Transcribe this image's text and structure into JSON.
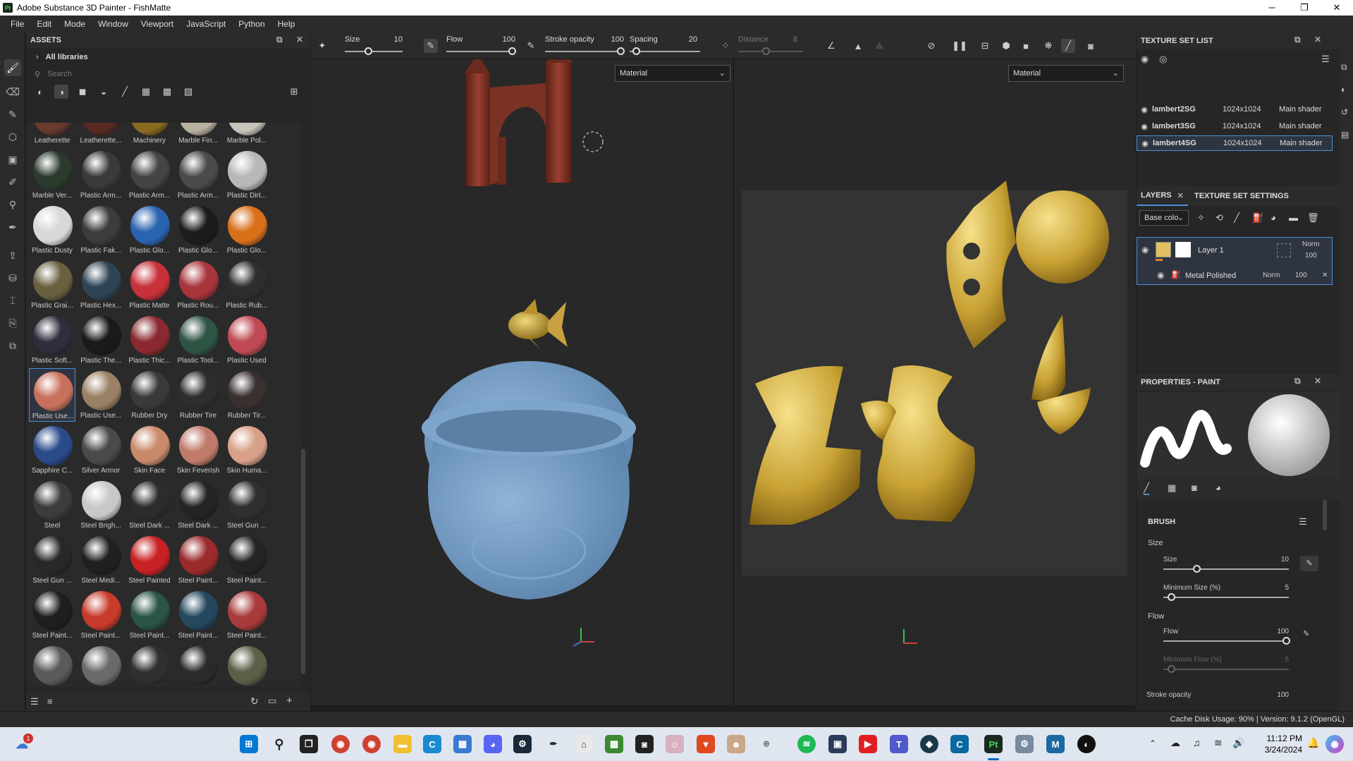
{
  "window": {
    "title": "Adobe Substance 3D Painter - FishMatte",
    "app_icon": "Pt",
    "minimize": "─",
    "maximize": "❐",
    "close": "✕"
  },
  "menu": [
    "File",
    "Edit",
    "Mode",
    "Window",
    "Viewport",
    "JavaScript",
    "Python",
    "Help"
  ],
  "assets": {
    "title": "ASSETS",
    "library": "All libraries",
    "search_placeholder": "Search",
    "materials": [
      {
        "label": "Leatherette",
        "color": "#6a3a2e"
      },
      {
        "label": "Leatherette...",
        "color": "#5a2a22"
      },
      {
        "label": "Machinery",
        "color": "#8a6a20"
      },
      {
        "label": "Marble Fin...",
        "color": "#b8b0a0"
      },
      {
        "label": "Marble Pol...",
        "color": "#c8c4bc"
      },
      {
        "label": "Marble Ver...",
        "color": "#2a3a2c"
      },
      {
        "label": "Plastic Arm...",
        "color": "#3a3a3c"
      },
      {
        "label": "Plastic Arm...",
        "color": "#444446"
      },
      {
        "label": "Plastic Arm...",
        "color": "#4a4a4c"
      },
      {
        "label": "Plastic Dirt...",
        "color": "#b8b8b8"
      },
      {
        "label": "Plastic Dusty",
        "color": "#d8d8d8"
      },
      {
        "label": "Plastic Fak...",
        "color": "#3c3c3e"
      },
      {
        "label": "Plastic Glo...",
        "color": "#2a64b0"
      },
      {
        "label": "Plastic Glo...",
        "color": "#1c1c1e"
      },
      {
        "label": "Plastic Glo...",
        "color": "#d8701a"
      },
      {
        "label": "Plastic Grai...",
        "color": "#6a6040"
      },
      {
        "label": "Plastic Hex...",
        "color": "#2e4454"
      },
      {
        "label": "Plastic Matte",
        "color": "#c8303a"
      },
      {
        "label": "Plastic Rou...",
        "color": "#a8343c"
      },
      {
        "label": "Plastic Rub...",
        "color": "#2e2e2e"
      },
      {
        "label": "Plastic Soft...",
        "color": "#2e2e3e"
      },
      {
        "label": "Plastic The...",
        "color": "#1a1a1c"
      },
      {
        "label": "Plastic Thic...",
        "color": "#8a2a30"
      },
      {
        "label": "Plastic Tool...",
        "color": "#2e5444"
      },
      {
        "label": "Plastic Used",
        "color": "#c04a54"
      },
      {
        "label": "Plastic Use...",
        "color": "#c8705c"
      },
      {
        "label": "Plastic Use...",
        "color": "#9a8064"
      },
      {
        "label": "Rubber Dry",
        "color": "#3a3a3a"
      },
      {
        "label": "Rubber Tire",
        "color": "#2e2e2e"
      },
      {
        "label": "Rubber Tir...",
        "color": "#3a3030"
      },
      {
        "label": "Sapphire C...",
        "color": "#2a4a8a"
      },
      {
        "label": "Silver Armor",
        "color": "#4a4a4c"
      },
      {
        "label": "Skin Face",
        "color": "#c88a6a"
      },
      {
        "label": "Skin Feverish",
        "color": "#c07a6a"
      },
      {
        "label": "Skin Huma...",
        "color": "#d8a088"
      },
      {
        "label": "Steel",
        "color": "#3c3c3e"
      },
      {
        "label": "Steel Brigh...",
        "color": "#c8c8c8"
      },
      {
        "label": "Steel Dark ...",
        "color": "#2c2c2e"
      },
      {
        "label": "Steel Dark ...",
        "color": "#242426"
      },
      {
        "label": "Steel Gun ...",
        "color": "#303032"
      },
      {
        "label": "Steel Gun ...",
        "color": "#282828"
      },
      {
        "label": "Steel Medi...",
        "color": "#1e2022"
      },
      {
        "label": "Steel Painted",
        "color": "#c82024"
      },
      {
        "label": "Steel Paint...",
        "color": "#9a2a2c"
      },
      {
        "label": "Steel Paint...",
        "color": "#242426"
      },
      {
        "label": "Steel Paint...",
        "color": "#1e1e1e"
      },
      {
        "label": "Steel Paint...",
        "color": "#c83a2a"
      },
      {
        "label": "Steel Paint...",
        "color": "#2a5444"
      },
      {
        "label": "Steel Paint...",
        "color": "#24485e"
      },
      {
        "label": "Steel Paint...",
        "color": "#a83a3c"
      },
      {
        "label": "",
        "color": "#5a5a5a"
      },
      {
        "label": "",
        "color": "#6a6a6a"
      },
      {
        "label": "",
        "color": "#303032"
      },
      {
        "label": "",
        "color": "#2a2a2c"
      },
      {
        "label": "",
        "color": "#5a6048"
      }
    ],
    "selected_index": 25
  },
  "toolbar": {
    "size_label": "Size",
    "size_value": "10",
    "flow_label": "Flow",
    "flow_value": "100",
    "stroke_label": "Stroke opacity",
    "stroke_value": "100",
    "spacing_label": "Spacing",
    "spacing_value": "20",
    "distance_label": "Distance",
    "distance_value": "8"
  },
  "viewport3d": {
    "mode": "Material"
  },
  "viewport2d": {
    "mode": "Material"
  },
  "texture_sets": {
    "title": "TEXTURE SET LIST",
    "rows": [
      {
        "name": "lambert2SG",
        "res": "1024x1024",
        "shader": "Main shader"
      },
      {
        "name": "lambert3SG",
        "res": "1024x1024",
        "shader": "Main shader"
      },
      {
        "name": "lambert4SG",
        "res": "1024x1024",
        "shader": "Main shader"
      }
    ]
  },
  "layers": {
    "tab_layers": "LAYERS",
    "tab_settings": "TEXTURE SET SETTINGS",
    "channel": "Base colo",
    "layer_name": "Layer 1",
    "blend": "Norm",
    "opacity": "100",
    "effect_name": "Metal Polished",
    "effect_blend": "Norm",
    "effect_opacity": "100"
  },
  "properties": {
    "title": "PROPERTIES - PAINT",
    "brush": "BRUSH",
    "size_section": "Size",
    "size_label": "Size",
    "size_value": "10",
    "minsize_label": "Minimum Size (%)",
    "minsize_value": "5",
    "flow_section": "Flow",
    "flow_label": "Flow",
    "flow_value": "100",
    "minflow_label": "Minimum Flow (%)",
    "minflow_value": "5",
    "stroke_label": "Stroke opacity",
    "stroke_value": "100"
  },
  "status": {
    "text": "Cache Disk Usage:   90% | Version: 9.1.2 (OpenGL)"
  },
  "taskbar": {
    "time": "11:12 PM",
    "date": "3/24/2024",
    "notif": "1"
  }
}
